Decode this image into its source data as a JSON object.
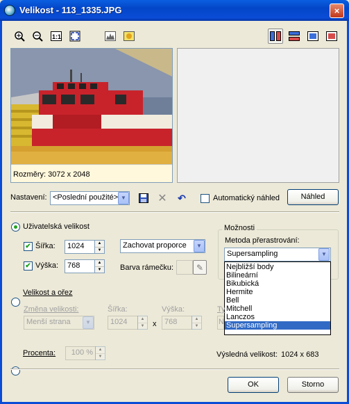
{
  "window": {
    "title": "Velikost - 113_1335.JPG",
    "close": "×"
  },
  "preview": {
    "dimensions": "Rozměry: 3072 x 2048"
  },
  "preset": {
    "label": "Nastavení:",
    "value": "<Poslední použité>",
    "auto_preview": "Automatický náhled",
    "auto_checked": false,
    "preview_button": "Náhled"
  },
  "user_size": {
    "label": "Uživatelská velikost",
    "selected": true,
    "width_label": "Šířka:",
    "width_value": "1024",
    "width_checked": true,
    "height_label": "Výška:",
    "height_value": "768",
    "height_checked": true,
    "proportion": "Zachovat proporce",
    "frame_color_label": "Barva rámečku:"
  },
  "size_crop": {
    "label": "Velikost a ořez",
    "selected": false,
    "resize_label": "Změna velikosti:",
    "resize_value": "Menší strana",
    "width_label": "Šířka:",
    "width_value": "1024",
    "x": "x",
    "height_label": "Výška:",
    "height_value": "768",
    "type_label": "Ty",
    "type_value": "N"
  },
  "percent": {
    "label": "Procenta:",
    "selected": false,
    "value": "100 %"
  },
  "options": {
    "title": "Možnosti",
    "method_label": "Metoda přerastrování:",
    "method_value": "Supersampling",
    "methods": [
      "Nejbližší body",
      "Bilineární",
      "Bikubická",
      "Hermite",
      "Bell",
      "Mitchell",
      "Lanczos",
      "Supersampling"
    ],
    "selected_index": 7
  },
  "result": {
    "label": "Výsledná velikost:",
    "value": "1024 x 683"
  },
  "buttons": {
    "ok": "OK",
    "cancel": "Storno"
  },
  "colors": {
    "title_bar": "#0a4cd6",
    "dialog_bg": "#ece9d8",
    "selection": "#316ac5"
  }
}
